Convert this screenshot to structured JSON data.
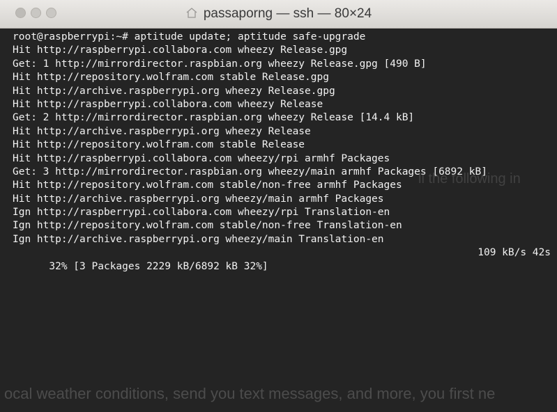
{
  "window": {
    "title": "passaporng — ssh — 80×24",
    "title_icon": "home-icon"
  },
  "terminal": {
    "lines": [
      "root@raspberrypi:~# aptitude update; aptitude safe-upgrade",
      "Hit http://raspberrypi.collabora.com wheezy Release.gpg",
      "Get: 1 http://mirrordirector.raspbian.org wheezy Release.gpg [490 B]",
      "Hit http://repository.wolfram.com stable Release.gpg",
      "Hit http://archive.raspberrypi.org wheezy Release.gpg",
      "Hit http://raspberrypi.collabora.com wheezy Release",
      "Get: 2 http://mirrordirector.raspbian.org wheezy Release [14.4 kB]",
      "Hit http://archive.raspberrypi.org wheezy Release",
      "Hit http://repository.wolfram.com stable Release",
      "Hit http://raspberrypi.collabora.com wheezy/rpi armhf Packages",
      "Get: 3 http://mirrordirector.raspbian.org wheezy/main armhf Packages [6892 kB]",
      "Hit http://repository.wolfram.com stable/non-free armhf Packages",
      "Hit http://archive.raspberrypi.org wheezy/main armhf Packages",
      "Ign http://raspberrypi.collabora.com wheezy/rpi Translation-en",
      "Ign http://repository.wolfram.com stable/non-free Translation-en",
      "Ign http://archive.raspberrypi.org wheezy/main Translation-en"
    ],
    "status_left": "32% [3 Packages 2229 kB/6892 kB 32%]",
    "status_right": "109 kB/s 42s"
  },
  "bleed_through": {
    "upper": "ll the following in",
    "lower": "ocal weather conditions, send you text messages, and more, you first ne"
  }
}
